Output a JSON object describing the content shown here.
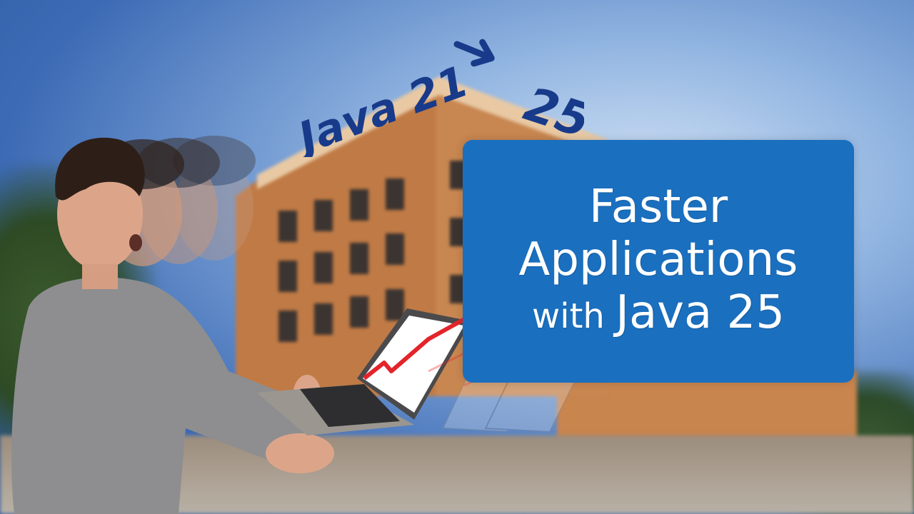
{
  "headline": {
    "from_version": "Java 21",
    "to_version": "25"
  },
  "title_card": {
    "line1": "Faster",
    "line2": "Applications",
    "line3_prefix": "with",
    "line3_main": "Java 25"
  },
  "colors": {
    "card_blue": "#1a6fbf",
    "headline_navy": "#183a8a",
    "trend_red": "#e3242b",
    "building_orange": "#c9854e"
  },
  "icons": [
    "arrow-right-icon",
    "trend-up-icon"
  ]
}
